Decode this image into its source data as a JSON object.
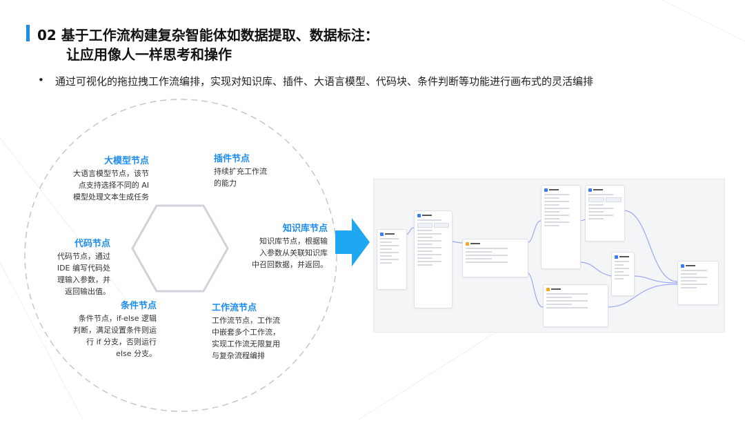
{
  "title": {
    "line1": "02 基于工作流构建复杂智能体如数据提取、数据标注：",
    "line2": "让应用像人一样思考和操作"
  },
  "bullet": {
    "marker": "•",
    "text": "通过可视化的拖拉拽工作流编排，实现对知识库、插件、大语言模型、代码块、条件判断等功能进行画布式的灵活编排"
  },
  "nodes": {
    "llm": {
      "title": "大模型节点",
      "lines": [
        "大语言模型节点，该节",
        "点支持选择不同的 AI",
        "模型处理文本生成任务"
      ]
    },
    "plugin": {
      "title": "插件节点",
      "lines": [
        "持续扩充工作流",
        "的能力"
      ]
    },
    "knowledge": {
      "title": "知识库节点",
      "lines": [
        "知识库节点，根据输",
        "入参数从关联知识库",
        "中召回数据，并返回。"
      ]
    },
    "code": {
      "title": "代码节点",
      "lines": [
        "代码节点，通过",
        "IDE 编写代码处",
        "理输入参数，并",
        "返回输出值。"
      ]
    },
    "condition": {
      "title": "条件节点",
      "lines": [
        "条件节点，if-else 逻辑",
        "判断，满足设置条件则运",
        "行 if 分支，否则运行",
        "else 分支。"
      ]
    },
    "workflow": {
      "title": "工作流节点",
      "lines": [
        "工作流节点，工作流",
        "中嵌套多个工作流，",
        "实现工作流无限复用",
        "与复杂流程编排"
      ]
    }
  },
  "colors": {
    "accent": "#1c8cf0",
    "arrow": "#1ea8f2"
  },
  "icons": [
    "hexagon-icon",
    "arrow-right-icon"
  ]
}
